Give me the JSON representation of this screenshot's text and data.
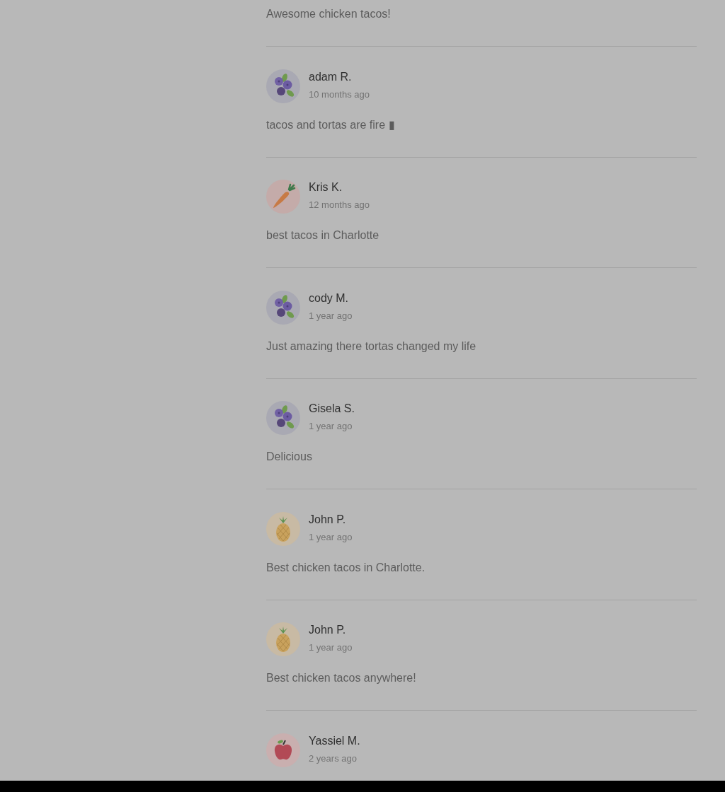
{
  "reviews": [
    {
      "text": "Awesome chicken tacos!"
    },
    {
      "author": "adam R.",
      "time": "10 months ago",
      "avatar": {
        "kind": "blueberries"
      },
      "text": "tacos and tortas are fire ▮"
    },
    {
      "author": "Kris K.",
      "time": "12 months ago",
      "avatar": {
        "kind": "carrot"
      },
      "text": "best tacos in Charlotte"
    },
    {
      "author": "cody M.",
      "time": "1 year ago",
      "avatar": {
        "kind": "blueberries"
      },
      "text": "Just amazing there tortas changed my life"
    },
    {
      "author": "Gisela S.",
      "time": "1 year ago",
      "avatar": {
        "kind": "blueberries"
      },
      "text": "Delicious"
    },
    {
      "author": "John P.",
      "time": "1 year ago",
      "avatar": {
        "kind": "pineapple"
      },
      "text": "Best chicken tacos in Charlotte."
    },
    {
      "author": "John P.",
      "time": "1 year ago",
      "avatar": {
        "kind": "pineapple"
      },
      "text": "Best chicken tacos anywhere!"
    },
    {
      "author": "Yassiel M.",
      "time": "2 years ago",
      "avatar": {
        "kind": "apple"
      }
    }
  ]
}
